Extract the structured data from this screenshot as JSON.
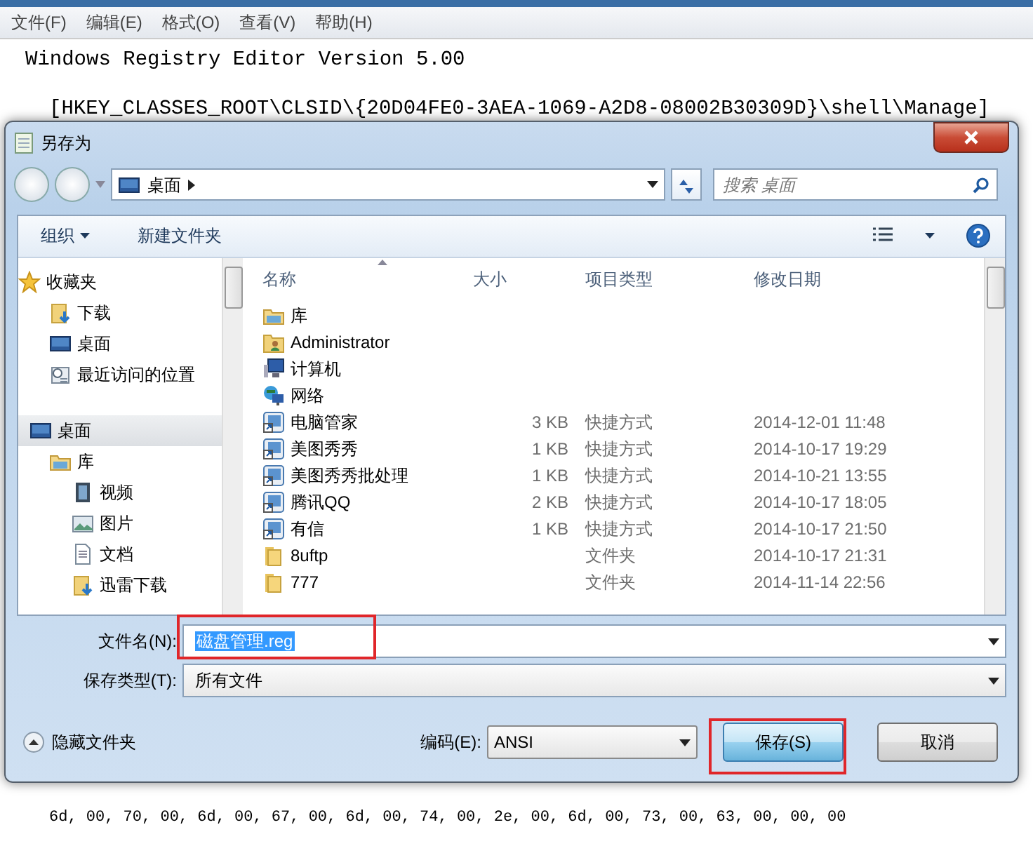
{
  "menu_bar": [
    {
      "label": "文件(F)"
    },
    {
      "label": "编辑(E)"
    },
    {
      "label": "格式(O)"
    },
    {
      "label": "查看(V)"
    },
    {
      "label": "帮助(H)"
    }
  ],
  "editor": {
    "lines_above": [
      "Windows Registry Editor Version 5.00",
      "[HKEY_CLASSES_ROOT\\CLSID\\{20D04FE0-3AEA-1069-A2D8-08002B30309D}\\shell\\Manage]"
    ],
    "lines_below": [
      "6d, 00, 70, 00, 6d, 00, 67, 00, 6d, 00, 74, 00, 2e, 00, 6d, 00, 73, 00, 63, 00, 00, 00"
    ]
  },
  "dialog": {
    "title": "另存为",
    "address": {
      "path": "桌面"
    },
    "search": {
      "placeholder": "搜索 桌面"
    },
    "toolbar": [
      {
        "label": "组织",
        "dropdown": true
      },
      {
        "label": "新建文件夹",
        "dropdown": false
      }
    ],
    "sidebar": [
      {
        "label": "收藏夹",
        "kind": "star",
        "selected": false,
        "children": [
          {
            "label": "下载",
            "kind": "download",
            "selected": false
          },
          {
            "label": "桌面",
            "kind": "desktop",
            "selected": false
          },
          {
            "label": "最近访问的位置",
            "kind": "recent",
            "selected": false
          }
        ]
      },
      {
        "label": "桌面",
        "kind": "desktop",
        "selected": true,
        "children": [
          {
            "label": "库",
            "kind": "library",
            "selected": false,
            "children": [
              {
                "label": "视频",
                "kind": "video",
                "selected": false
              },
              {
                "label": "图片",
                "kind": "picture",
                "selected": false
              },
              {
                "label": "文档",
                "kind": "document",
                "selected": false
              },
              {
                "label": "迅雷下载",
                "kind": "download",
                "selected": false
              }
            ]
          }
        ]
      }
    ],
    "columns": [
      "名称",
      "大小",
      "项目类型",
      "修改日期"
    ],
    "rows": [
      {
        "name": "库",
        "kind": "library",
        "size": "",
        "type": "",
        "modified": ""
      },
      {
        "name": "Administrator",
        "kind": "user",
        "size": "",
        "type": "",
        "modified": ""
      },
      {
        "name": "计算机",
        "kind": "computer",
        "size": "",
        "type": "",
        "modified": ""
      },
      {
        "name": "网络",
        "kind": "network",
        "size": "",
        "type": "",
        "modified": ""
      },
      {
        "name": "电脑管家",
        "kind": "shortcut",
        "size": "3 KB",
        "type": "快捷方式",
        "modified": "2014-12-01 11:48"
      },
      {
        "name": "美图秀秀",
        "kind": "shortcut",
        "size": "1 KB",
        "type": "快捷方式",
        "modified": "2014-10-17 19:29"
      },
      {
        "name": "美图秀秀批处理",
        "kind": "shortcut",
        "size": "1 KB",
        "type": "快捷方式",
        "modified": "2014-10-21 13:55"
      },
      {
        "name": "腾讯QQ",
        "kind": "shortcut",
        "size": "2 KB",
        "type": "快捷方式",
        "modified": "2014-10-17 18:05"
      },
      {
        "name": "有信",
        "kind": "shortcut",
        "size": "1 KB",
        "type": "快捷方式",
        "modified": "2014-10-17 21:50"
      },
      {
        "name": "8uftp",
        "kind": "folder",
        "size": "",
        "type": "文件夹",
        "modified": "2014-10-17 21:31"
      },
      {
        "name": "777",
        "kind": "folder",
        "size": "",
        "type": "文件夹",
        "modified": "2014-11-14 22:56"
      }
    ],
    "file_name": {
      "label": "文件名(N):",
      "value": "磁盘管理.reg",
      "text_selected": true
    },
    "file_type": {
      "label": "保存类型(T):",
      "value": "所有文件"
    },
    "hide_folders": {
      "label": "隐藏文件夹"
    },
    "encoding": {
      "label": "编码(E):",
      "value": "ANSI"
    },
    "buttons": [
      {
        "label": "保存(S)",
        "default": true
      },
      {
        "label": "取消",
        "default": false
      }
    ]
  }
}
